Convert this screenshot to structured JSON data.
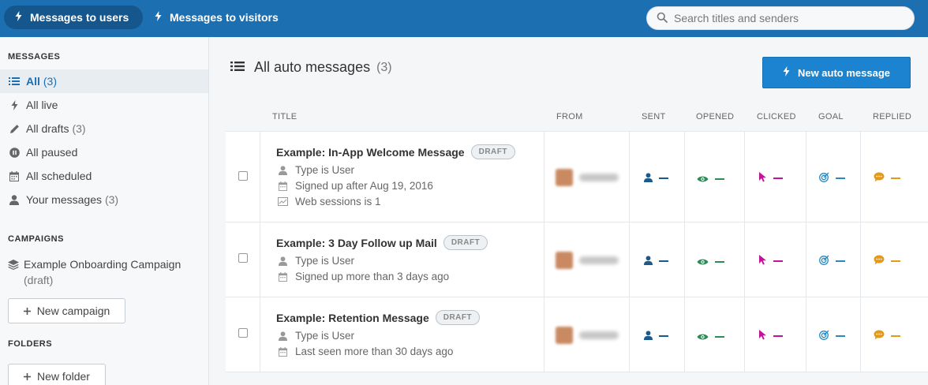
{
  "colors": {
    "brand": "#1c6fb1",
    "sent": "#1c5a8c",
    "opened": "#2e8b57",
    "clicked": "#c0149b",
    "goal": "#2a8ac0",
    "replied": "#e39a1a"
  },
  "topbar": {
    "tabs": [
      {
        "label": "Messages to users",
        "icon": "bolt-icon",
        "active": true
      },
      {
        "label": "Messages to visitors",
        "icon": "bolt-icon",
        "active": false
      }
    ],
    "search_placeholder": "Search titles and senders"
  },
  "sidebar": {
    "messages_heading": "MESSAGES",
    "items": [
      {
        "label": "All",
        "count": "(3)",
        "icon": "list-icon"
      },
      {
        "label": "All live",
        "count": "",
        "icon": "bolt-icon"
      },
      {
        "label": "All drafts",
        "count": "(3)",
        "icon": "pencil-icon"
      },
      {
        "label": "All paused",
        "count": "",
        "icon": "pause-icon"
      },
      {
        "label": "All scheduled",
        "count": "",
        "icon": "calendar-icon"
      },
      {
        "label": "Your messages",
        "count": "(3)",
        "icon": "user-icon"
      }
    ],
    "campaigns_heading": "CAMPAIGNS",
    "campaign_name": "Example Onboarding Campaign",
    "campaign_status": "(draft)",
    "new_campaign_label": "New campaign",
    "folders_heading": "FOLDERS",
    "new_folder_label": "New folder"
  },
  "main": {
    "title": "All auto messages",
    "count": "(3)",
    "new_button_label": "New auto message",
    "columns": [
      "TITLE",
      "FROM",
      "SENT",
      "OPENED",
      "CLICKED",
      "GOAL",
      "REPLIED"
    ],
    "rows": [
      {
        "title": "Example: In-App Welcome Message",
        "badge": "DRAFT",
        "rules": [
          {
            "icon": "user-icon",
            "text": "Type is User"
          },
          {
            "icon": "calendar-icon",
            "text": "Signed up after Aug 19, 2016"
          },
          {
            "icon": "browser-icon",
            "text": "Web sessions is 1"
          }
        ]
      },
      {
        "title": "Example: 3 Day Follow up Mail",
        "badge": "DRAFT",
        "rules": [
          {
            "icon": "user-icon",
            "text": "Type is User"
          },
          {
            "icon": "calendar-icon",
            "text": "Signed up more than 3 days ago"
          }
        ]
      },
      {
        "title": "Example: Retention Message",
        "badge": "DRAFT",
        "rules": [
          {
            "icon": "user-icon",
            "text": "Type is User"
          },
          {
            "icon": "calendar-icon",
            "text": "Last seen more than 30 days ago"
          }
        ]
      }
    ]
  }
}
